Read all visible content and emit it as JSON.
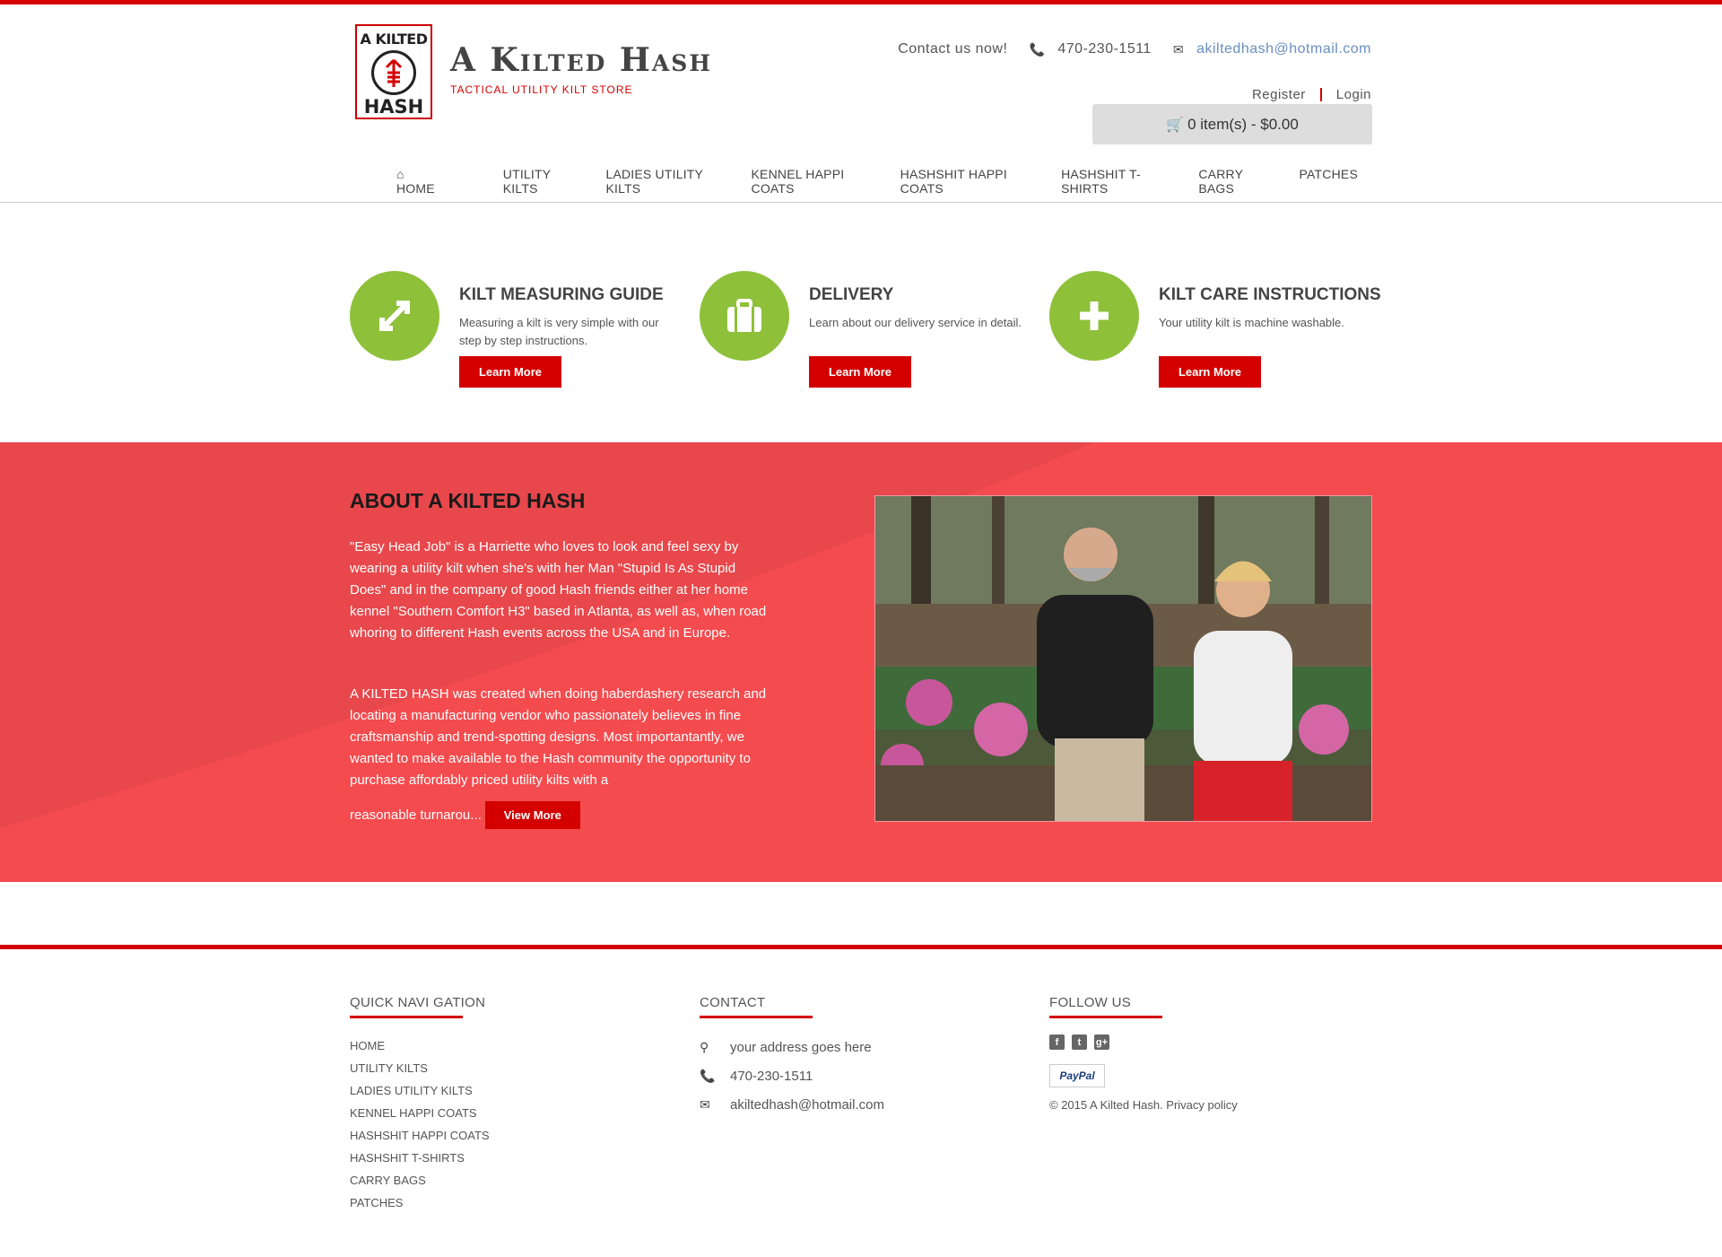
{
  "header": {
    "logo_top": "A KILTED",
    "logo_bottom": "HASH",
    "brand_name": "A Kilted Hash",
    "tagline": "TACTICAL UTILITY KILT STORE",
    "contact_label": "Contact us now!",
    "phone": "470-230-1511",
    "email": "akiltedhash@hotmail.com",
    "register": "Register",
    "login": "Login",
    "cart": "0 item(s) - $0.00"
  },
  "nav": {
    "items": [
      {
        "label": "HOME"
      },
      {
        "label": "UTILITY KILTS"
      },
      {
        "label": "LADIES UTILITY KILTS"
      },
      {
        "label": "KENNEL HAPPI COATS"
      },
      {
        "label": "HASHSHIT HAPPI COATS"
      },
      {
        "label": "HASHSHIT T-SHIRTS"
      },
      {
        "label": "CARRY BAGS"
      },
      {
        "label": "PATCHES"
      }
    ]
  },
  "features": [
    {
      "icon": "arrows-expand-icon",
      "title": "KILT MEASURING GUIDE",
      "text": "Measuring a kilt is very simple with our step by step instructions.",
      "button": "Learn More"
    },
    {
      "icon": "briefcase-icon",
      "title": "DELIVERY",
      "text": "Learn about our delivery service in detail.",
      "button": "Learn More"
    },
    {
      "icon": "plus-icon",
      "title": "KILT CARE INSTRUCTIONS",
      "text": "Your utility kilt is machine washable.",
      "button": "Learn More"
    }
  ],
  "about": {
    "title": "ABOUT A KILTED HASH",
    "p1": "\"Easy Head Job\" is a Harriette who loves to look and feel sexy by wearing a utility kilt when she's with her Man \"Stupid Is As Stupid Does\" and in the company of good Hash friends either at her home kennel \"Southern Comfort H3\" based in Atlanta, as well as, when road whoring to different Hash events across the USA and in Europe.",
    "p2": "A KILTED HASH was created when doing haberdashery research and locating a manufacturing vendor who passionately believes in fine craftsmanship and trend-spotting designs. Most importantantly, we wanted to make available to the Hash community the opportunity to purchase affordably priced utility kilts with a",
    "p2_end": "reasonable turnarou...",
    "button": "View More"
  },
  "footer": {
    "quick_nav_title": "QUICK NAVI GATION",
    "quick_nav": [
      "HOME",
      "UTILITY KILTS",
      "LADIES UTILITY KILTS",
      "KENNEL HAPPI COATS",
      "HASHSHIT HAPPI COATS",
      "HASHSHIT T-SHIRTS",
      "CARRY BAGS",
      "PATCHES"
    ],
    "contact_title": "CONTACT",
    "address": "your address goes here",
    "phone": "470-230-1511",
    "email": "akiltedhash@hotmail.com",
    "follow_title": "FOLLOW US",
    "paypal": "PayPal",
    "copyright": "© 2015 A Kilted Hash. Privacy policy"
  },
  "colors": {
    "accent_red": "#d40000",
    "about_band": "#f44b4e",
    "feature_green": "#8ec03a"
  }
}
